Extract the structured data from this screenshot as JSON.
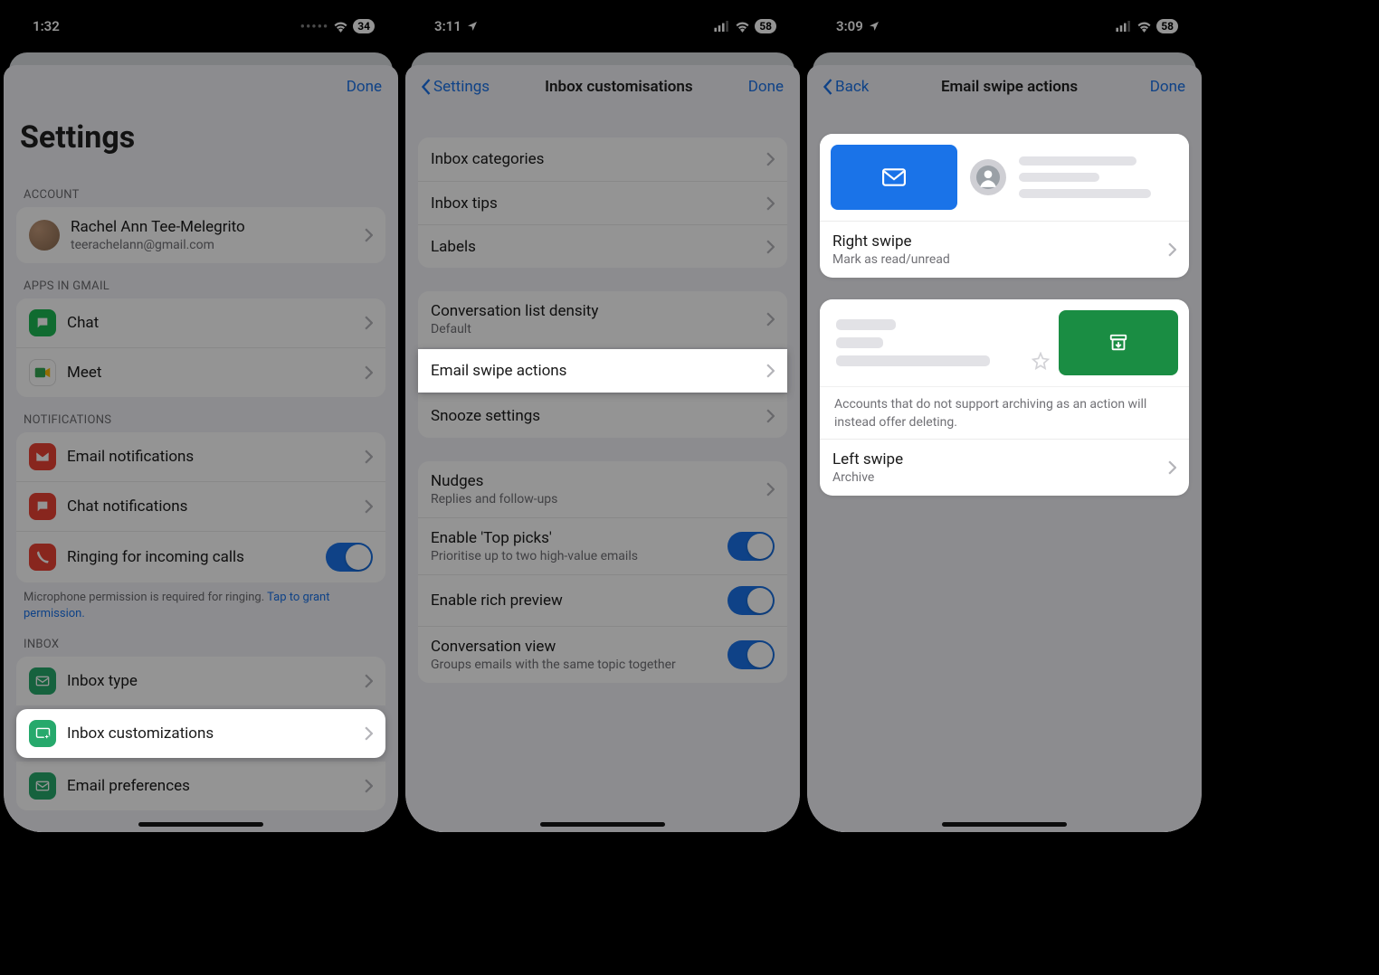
{
  "s1": {
    "time": "1:32",
    "battery": "34",
    "done": "Done",
    "title": "Settings",
    "section_account": "ACCOUNT",
    "account_name": "Rachel Ann Tee-Melegrito",
    "account_email": "teerachelann@gmail.com",
    "section_apps": "APPS IN GMAIL",
    "chat": "Chat",
    "meet": "Meet",
    "section_notifs": "NOTIFICATIONS",
    "email_notifs": "Email notifications",
    "chat_notifs": "Chat notifications",
    "ringing": "Ringing for incoming calls",
    "mic_note_a": "Microphone permission is required for ringing. ",
    "mic_note_link": "Tap to grant permission.",
    "section_inbox": "INBOX",
    "inbox_type": "Inbox type",
    "inbox_custom": "Inbox customizations",
    "email_prefs": "Email preferences"
  },
  "s2": {
    "time": "3:11",
    "battery": "58",
    "back": "Settings",
    "title": "Inbox customisations",
    "done": "Done",
    "inbox_cats": "Inbox categories",
    "inbox_tips": "Inbox tips",
    "labels": "Labels",
    "density": "Conversation list density",
    "density_sub": "Default",
    "swipe": "Email swipe actions",
    "snooze": "Snooze settings",
    "nudges": "Nudges",
    "nudges_sub": "Replies and follow-ups",
    "top_picks": "Enable 'Top picks'",
    "top_picks_sub": "Prioritise up to two high-value emails",
    "rich": "Enable rich preview",
    "conv": "Conversation view",
    "conv_sub": "Groups emails with the same topic together"
  },
  "s3": {
    "time": "3:09",
    "battery": "58",
    "back": "Back",
    "title": "Email swipe actions",
    "done": "Done",
    "right_swipe": "Right swipe",
    "right_swipe_sub": "Mark as read/unread",
    "archive_note": "Accounts that do not support archiving as an action will instead offer deleting.",
    "left_swipe": "Left swipe",
    "left_swipe_sub": "Archive"
  }
}
